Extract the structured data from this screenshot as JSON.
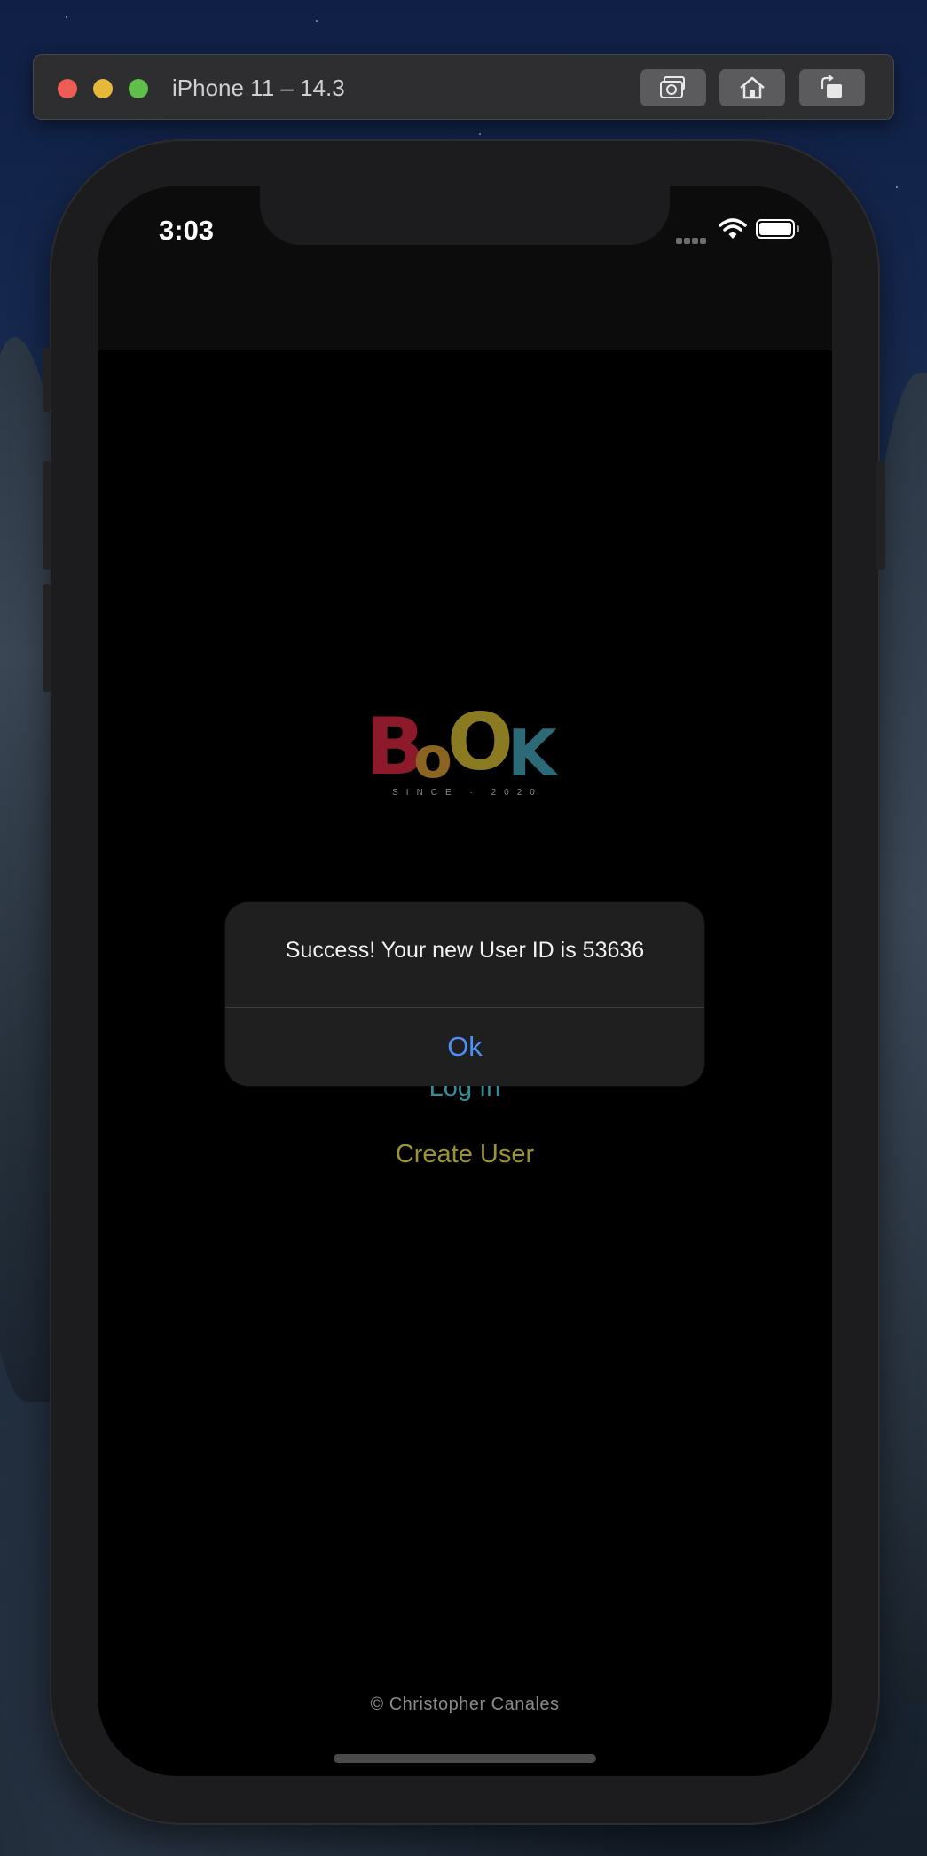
{
  "simulator": {
    "title": "iPhone 11 – 14.3",
    "buttons": [
      "screenshot-icon",
      "home-icon",
      "rotate-icon"
    ]
  },
  "status_bar": {
    "time": "3:03"
  },
  "logo": {
    "letters": [
      "B",
      "o",
      "O",
      "K"
    ],
    "colors": [
      "#8c1a2a",
      "#8a6420",
      "#8a7a22",
      "#2c6a78"
    ],
    "tagline": "SINCE · 2020"
  },
  "main": {
    "login_label": "Log In",
    "create_user_label": "Create User"
  },
  "alert": {
    "message": "Success! Your new User ID is 53636",
    "ok_label": "Ok"
  },
  "footer": {
    "copyright": "© Christopher Canales"
  },
  "colors": {
    "login_link": "#2f8f9a",
    "create_link": "#9c9432",
    "alert_button": "#4e8ef7"
  }
}
